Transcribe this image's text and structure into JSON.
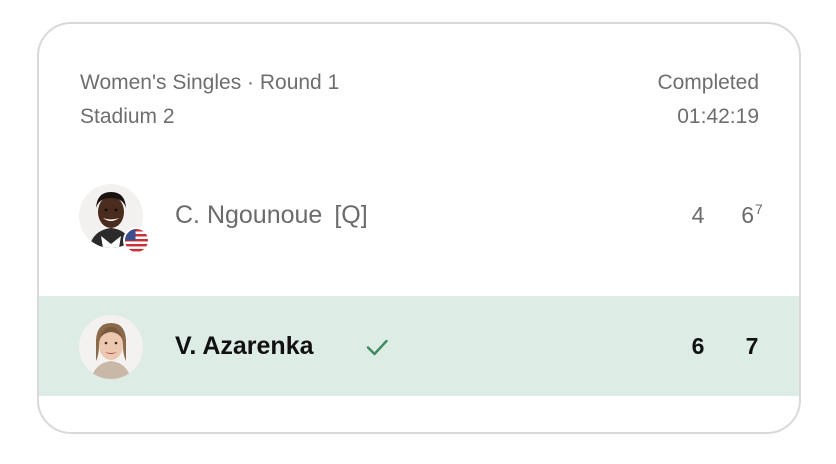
{
  "match": {
    "event": "Women's Singles · Round 1",
    "court": "Stadium 2",
    "status": "Completed",
    "duration": "01:42:19"
  },
  "players": [
    {
      "name": "C. Ngounoue",
      "seed": "[Q]",
      "flag_icon": "us-flag-icon",
      "sets": [
        "4",
        "6"
      ],
      "tiebreak": "7",
      "winner": false
    },
    {
      "name": "V. Azarenka",
      "seed": "",
      "sets": [
        "6",
        "7"
      ],
      "winner": true
    }
  ],
  "colors": {
    "winner_row_bg": "#deece6",
    "check_green": "#3c8a5e",
    "muted_text": "#6e6e6e",
    "strong_text": "#111111",
    "card_border": "#d9d9d9"
  }
}
